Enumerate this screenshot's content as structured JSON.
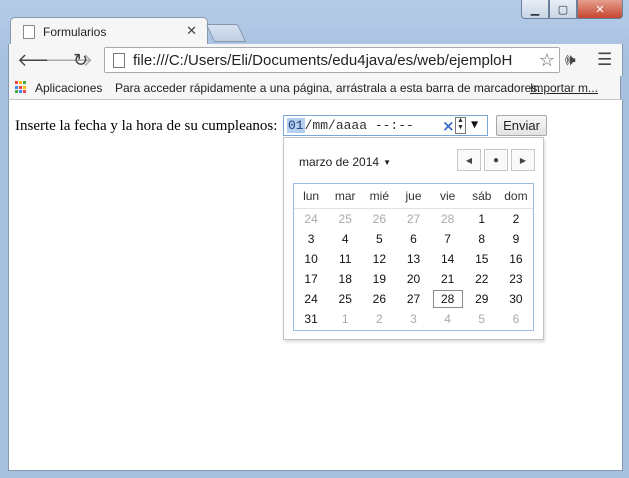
{
  "browser": {
    "tab_title": "Formularios",
    "url": "file:///C:/Users/Eli/Documents/edu4java/es/web/ejemploH",
    "bookmarks": {
      "apps_label": "Aplicaciones",
      "hint": "Para acceder rápidamente a una página, arrástrala a esta barra de marcadores.",
      "import_label": "Importar m..."
    }
  },
  "form": {
    "label": "Inserte la fecha y la hora de su cumpleanos:",
    "date_segment_selected": "01",
    "date_rest": "/mm/aaaa --:--",
    "submit_label": "Enviar"
  },
  "calendar": {
    "month_label": "marzo de 2014",
    "weekdays": [
      "lun",
      "mar",
      "mié",
      "jue",
      "vie",
      "sáb",
      "dom"
    ],
    "days": [
      {
        "d": "24",
        "other": true
      },
      {
        "d": "25",
        "other": true
      },
      {
        "d": "26",
        "other": true
      },
      {
        "d": "27",
        "other": true
      },
      {
        "d": "28",
        "other": true
      },
      {
        "d": "1"
      },
      {
        "d": "2"
      },
      {
        "d": "3"
      },
      {
        "d": "4"
      },
      {
        "d": "5"
      },
      {
        "d": "6"
      },
      {
        "d": "7"
      },
      {
        "d": "8"
      },
      {
        "d": "9"
      },
      {
        "d": "10"
      },
      {
        "d": "11"
      },
      {
        "d": "12"
      },
      {
        "d": "13"
      },
      {
        "d": "14"
      },
      {
        "d": "15"
      },
      {
        "d": "16"
      },
      {
        "d": "17"
      },
      {
        "d": "18"
      },
      {
        "d": "19"
      },
      {
        "d": "20"
      },
      {
        "d": "21"
      },
      {
        "d": "22"
      },
      {
        "d": "23"
      },
      {
        "d": "24"
      },
      {
        "d": "25"
      },
      {
        "d": "26"
      },
      {
        "d": "27"
      },
      {
        "d": "28",
        "today": true
      },
      {
        "d": "29"
      },
      {
        "d": "30"
      },
      {
        "d": "31"
      },
      {
        "d": "1",
        "other": true
      },
      {
        "d": "2",
        "other": true
      },
      {
        "d": "3",
        "other": true
      },
      {
        "d": "4",
        "other": true
      },
      {
        "d": "5",
        "other": true
      },
      {
        "d": "6",
        "other": true
      }
    ]
  },
  "colors": {
    "selection": "#b5cfee",
    "close_button": "#c6452f",
    "calendar_border": "#9cbbe0"
  }
}
